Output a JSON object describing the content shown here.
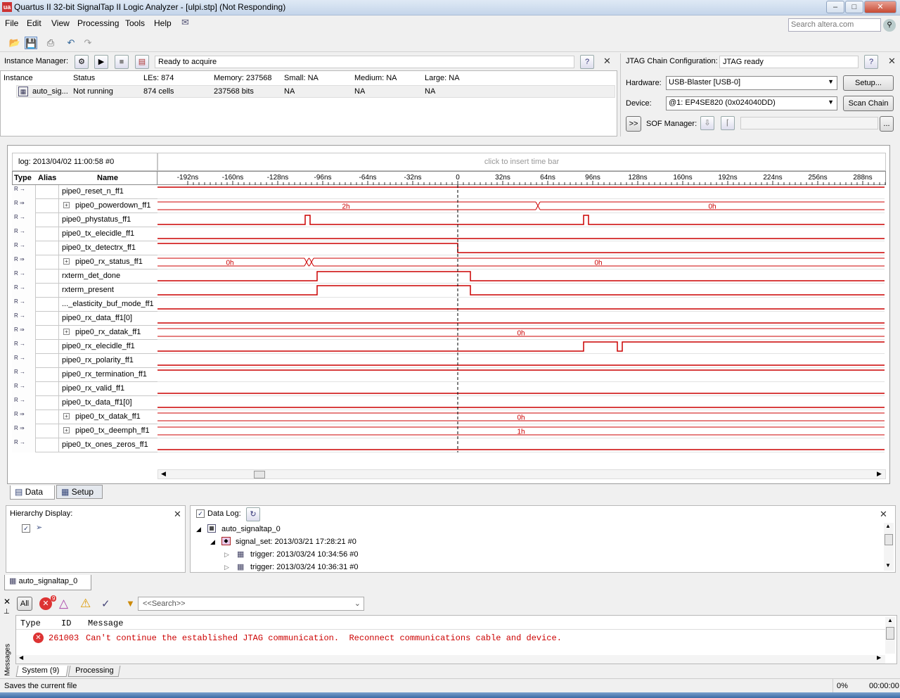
{
  "window": {
    "title": "Quartus II 32-bit SignalTap II Logic Analyzer - [ulpi.stp] (Not Responding)",
    "app_icon_text": "ua"
  },
  "menu": [
    "File",
    "Edit",
    "View",
    "Processing",
    "Tools",
    "Help"
  ],
  "search": {
    "placeholder": "Search altera.com"
  },
  "instance_manager": {
    "label": "Instance Manager:",
    "status": "Ready to acquire",
    "headers": [
      "Instance",
      "Status",
      "LEs: 874",
      "Memory: 237568",
      "Small: NA",
      "Medium: NA",
      "Large: NA"
    ],
    "row": [
      "auto_sig...",
      "Not running",
      "874 cells",
      "237568 bits",
      "NA",
      "NA",
      "NA"
    ]
  },
  "jtag": {
    "label": "JTAG Chain Configuration:",
    "status": "JTAG ready",
    "hardware_label": "Hardware:",
    "hardware_value": "USB-Blaster [USB-0]",
    "setup_button": "Setup...",
    "device_label": "Device:",
    "device_value": "@1: EP4SE820 (0x024040DD)",
    "scan_button": "Scan Chain",
    "sof_toggle": ">>",
    "sof_label": "SOF Manager:",
    "browse_button": "..."
  },
  "waveform": {
    "log_label": "log: 2013/04/02 11:00:58  #0",
    "insert_hint": "click to insert time bar",
    "col_type": "Type",
    "col_alias": "Alias",
    "col_name": "Name",
    "ticks": [
      "-192ns",
      "-160ns",
      "-128ns",
      "-96ns",
      "-64ns",
      "-32ns",
      "0",
      "32ns",
      "64ns",
      "96ns",
      "128ns",
      "160ns",
      "192ns",
      "224ns",
      "256ns",
      "288ns"
    ],
    "signals": [
      {
        "name": "pipe0_reset_n_ff1",
        "bus": false
      },
      {
        "name": "pipe0_powerdown_ff1",
        "bus": true
      },
      {
        "name": "pipe0_phystatus_ff1",
        "bus": false
      },
      {
        "name": "pipe0_tx_elecidle_ff1",
        "bus": false
      },
      {
        "name": "pipe0_tx_detectrx_ff1",
        "bus": false
      },
      {
        "name": "pipe0_rx_status_ff1",
        "bus": true
      },
      {
        "name": "rxterm_det_done",
        "bus": false
      },
      {
        "name": "rxterm_present",
        "bus": false
      },
      {
        "name": "..._elasticity_buf_mode_ff1",
        "bus": false
      },
      {
        "name": "pipe0_rx_data_ff1[0]",
        "bus": false
      },
      {
        "name": "pipe0_rx_datak_ff1",
        "bus": true
      },
      {
        "name": "pipe0_rx_elecidle_ff1",
        "bus": false
      },
      {
        "name": "pipe0_rx_polarity_ff1",
        "bus": false
      },
      {
        "name": "pipe0_rx_termination_ff1",
        "bus": false
      },
      {
        "name": "pipe0_rx_valid_ff1",
        "bus": false
      },
      {
        "name": "pipe0_tx_data_ff1[0]",
        "bus": false
      },
      {
        "name": "pipe0_tx_datak_ff1",
        "bus": true
      },
      {
        "name": "pipe0_tx_deemph_ff1",
        "bus": true
      },
      {
        "name": "pipe0_tx_ones_zeros_ff1",
        "bus": false
      }
    ],
    "bus_values": {
      "powerdown_a": "2h",
      "powerdown_b": "0h",
      "rx_status_a": "0h",
      "rx_status_b": "0h",
      "rx_datak": "0h",
      "tx_datak": "0h",
      "tx_deemph": "1h"
    },
    "type_glyph": "R"
  },
  "tabs": {
    "data": "Data",
    "setup": "Setup"
  },
  "hierarchy": {
    "label": "Hierarchy Display:"
  },
  "datalog": {
    "label": "Data Log:",
    "root": "auto_signaltap_0",
    "signal_set": "signal_set: 2013/03/21 17:28:21  #0",
    "trigger1": "trigger: 2013/03/24 10:34:56  #0",
    "trigger2": "trigger: 2013/03/24 10:36:31  #0"
  },
  "instance_tab": "auto_signaltap_0",
  "messages": {
    "filter_all": "All",
    "error_count": "9",
    "search_placeholder": "<<Search>>",
    "col_type": "Type",
    "col_id": "ID",
    "col_message": "Message",
    "id": "261003",
    "text": "Can't continue the established JTAG communication.  Reconnect communications cable and device.",
    "side_label": "Messages",
    "tab_system": "System (9)",
    "tab_processing": "Processing"
  },
  "statusbar": {
    "text": "Saves the current file",
    "progress": "0%",
    "time": "00:00:00"
  },
  "colors": {
    "waveform": "#cc0000",
    "titlebar": "#c4d5ea"
  }
}
